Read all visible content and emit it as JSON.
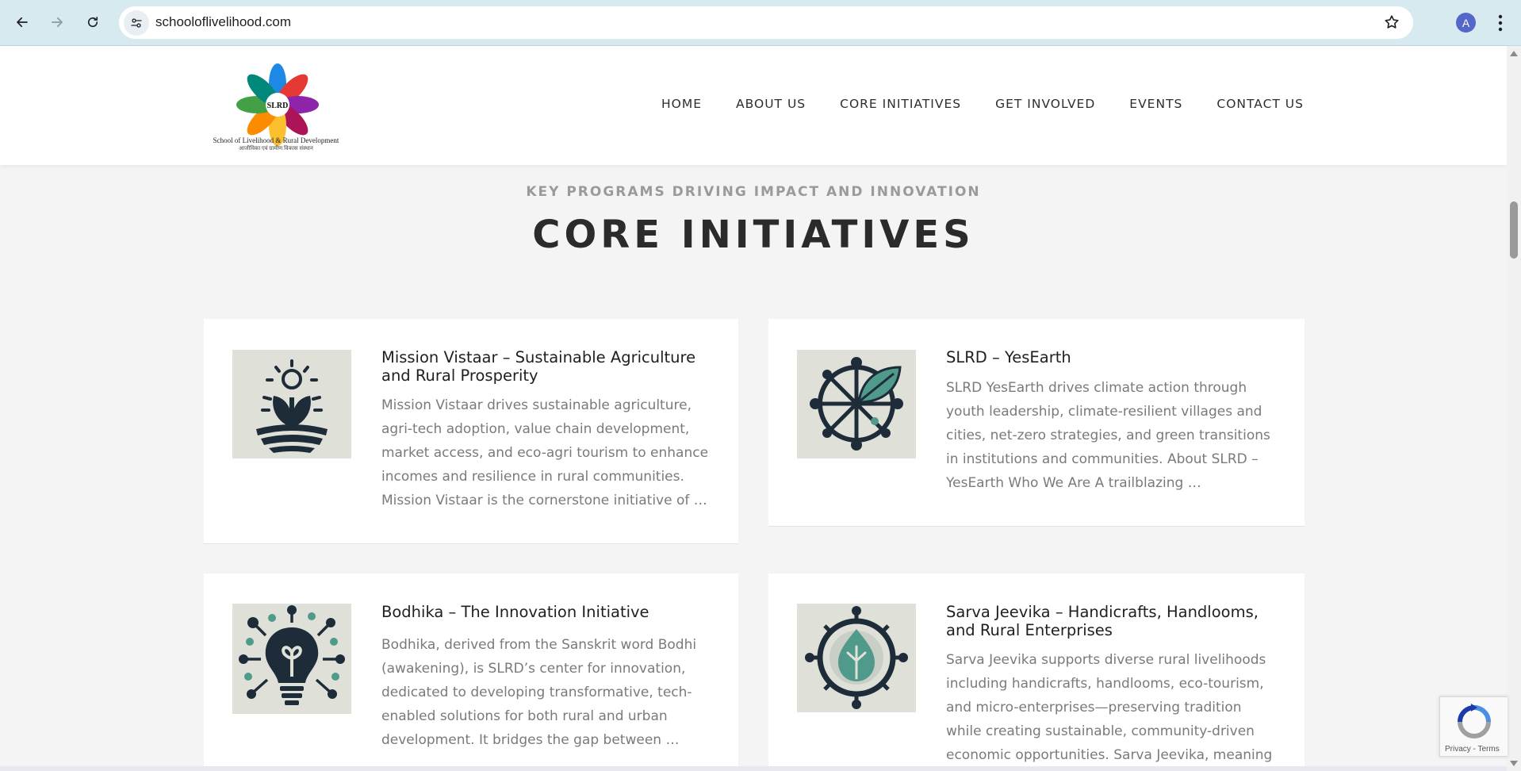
{
  "browser": {
    "url": "schooloflivelihood.com",
    "avatar_letter": "A"
  },
  "site": {
    "logo_caption_en": "School of Livelihood & Rural Development",
    "logo_caption_hi": "आजीविका एवं ग्रामीण विकास संस्थान",
    "logo_center_text": "SLRD",
    "nav": {
      "home": "HOME",
      "about": "ABOUT US",
      "core": "CORE INITIATIVES",
      "involved": "GET INVOLVED",
      "events": "EVENTS",
      "contact": "CONTACT US"
    }
  },
  "section": {
    "kicker": "KEY PROGRAMS DRIVING IMPACT AND INNOVATION",
    "title": "CORE INITIATIVES"
  },
  "cards": [
    {
      "title": "Mission Vistaar – Sustainable Agriculture and Rural Prosperity",
      "text": "Mission Vistaar drives sustainable agriculture, agri-tech adoption, value chain development, market access, and eco-agri tourism to enhance incomes and resilience in rural communities. Mission Vistaar is the cornerstone initiative of …",
      "icon": "sprout-sun-icon"
    },
    {
      "title": "SLRD – YesEarth",
      "text": "SLRD YesEarth drives climate action through youth leadership, climate-resilient villages and cities, net-zero strategies, and green transitions in institutions and communities. About SLRD – YesEarth Who We Are A trailblazing …",
      "icon": "leaf-wheel-icon"
    },
    {
      "title": "Bodhika – The Innovation Initiative",
      "text": "Bodhika, derived from the Sanskrit word Bodhi (awakening), is SLRD’s center for innovation, dedicated to developing transformative, tech-enabled solutions for both rural and urban development. It bridges the gap between …",
      "icon": "lightbulb-network-icon"
    },
    {
      "title": "Sarva Jeevika – Handicrafts, Handlooms, and Rural Enterprises",
      "text": "Sarva Jeevika supports diverse rural livelihoods including handicrafts, handlooms, eco-tourism, and micro-enterprises—preserving tradition while creating sustainable, community-driven economic opportunities. Sarva Jeevika, meaning “livelihoods",
      "icon": "leaf-drop-gear-icon"
    }
  ],
  "recaptcha": {
    "text": "Privacy - Terms"
  },
  "colors": {
    "icon_dark": "#1e2b38",
    "icon_teal": "#4f9a8a",
    "icon_bg": "#dfe1d8"
  }
}
